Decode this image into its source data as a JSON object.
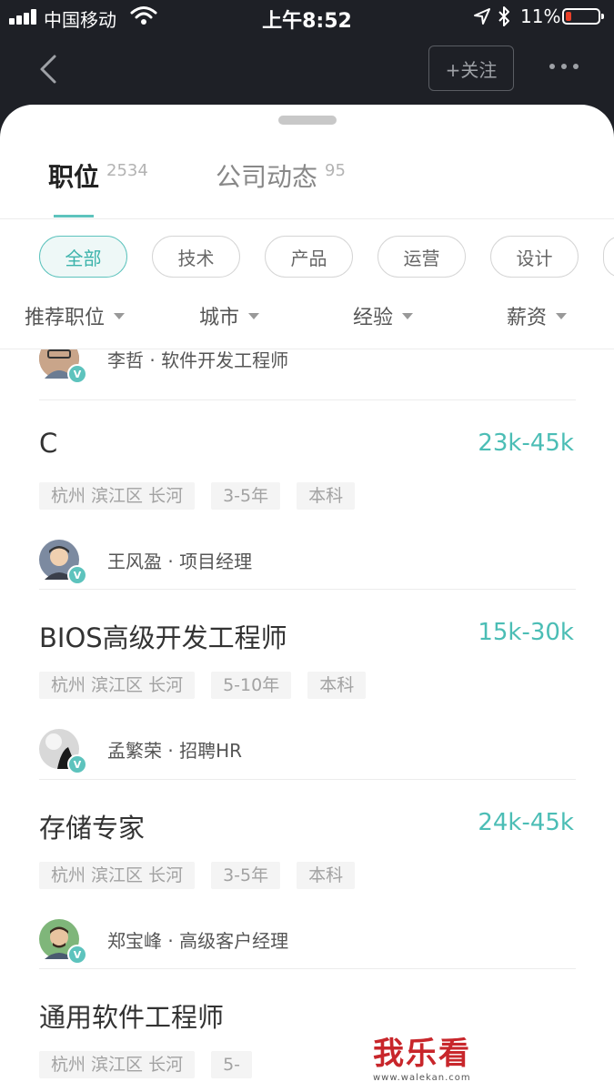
{
  "status_bar": {
    "carrier": "中国移动",
    "time": "上午8:52",
    "battery": "11%",
    "battery_level": 0.11,
    "colors": {
      "battery_low": "#e8402a"
    }
  },
  "nav": {
    "follow_label": "+关注"
  },
  "tabs": [
    {
      "label": "职位",
      "count": "2534",
      "active": true
    },
    {
      "label": "公司动态",
      "count": "95",
      "active": false
    }
  ],
  "categories": [
    {
      "label": "全部",
      "active": true
    },
    {
      "label": "技术",
      "active": false
    },
    {
      "label": "产品",
      "active": false
    },
    {
      "label": "运营",
      "active": false
    },
    {
      "label": "设计",
      "active": false
    }
  ],
  "filters": [
    "推荐职位",
    "城市",
    "经验",
    "薪资"
  ],
  "partial_recruiter": "李哲 · 软件开发工程师",
  "jobs": [
    {
      "title": "C",
      "salary": "23k-45k",
      "location": "杭州 滨江区 长河",
      "experience": "3-5年",
      "education": "本科",
      "recruiter": "王风盈 · 项目经理"
    },
    {
      "title": "BIOS高级开发工程师",
      "salary": "15k-30k",
      "location": "杭州 滨江区 长河",
      "experience": "5-10年",
      "education": "本科",
      "recruiter": "孟繁荣 · 招聘HR"
    },
    {
      "title": "存储专家",
      "salary": "24k-45k",
      "location": "杭州 滨江区 长河",
      "experience": "3-5年",
      "education": "本科",
      "recruiter": "郑宝峰 · 高级客户经理"
    },
    {
      "title": "通用软件工程师",
      "salary": "",
      "location": "杭州 滨江区 长河",
      "experience": "5-",
      "education": "",
      "recruiter": ""
    }
  ],
  "verified_mark": "V",
  "watermark": {
    "text": "我乐看",
    "url": "www.walekan.com"
  },
  "colors": {
    "accent": "#5dc3bd",
    "salary": "#4bbdb5",
    "header_bg": "#1e2026"
  }
}
